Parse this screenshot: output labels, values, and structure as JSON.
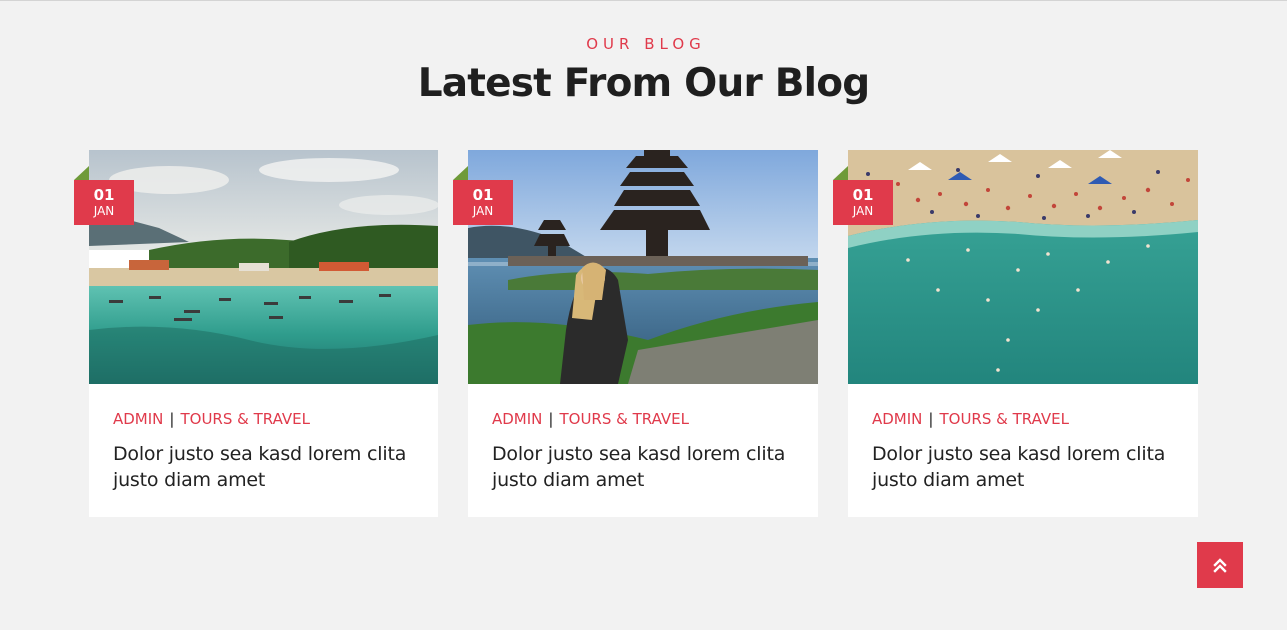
{
  "section": {
    "eyebrow": "OUR BLOG",
    "title": "Latest From Our Blog"
  },
  "posts": [
    {
      "date_day": "01",
      "date_month": "JAN",
      "author": "ADMIN",
      "category": "TOURS & TRAVEL",
      "title": "Dolor justo sea kasd lorem clita justo diam amet",
      "image": "tropical-beach-boats-photo"
    },
    {
      "date_day": "01",
      "date_month": "JAN",
      "author": "ADMIN",
      "category": "TOURS & TRAVEL",
      "title": "Dolor justo sea kasd lorem clita justo diam amet",
      "image": "lake-temple-woman-photo"
    },
    {
      "date_day": "01",
      "date_month": "JAN",
      "author": "ADMIN",
      "category": "TOURS & TRAVEL",
      "title": "Dolor justo sea kasd lorem clita justo diam amet",
      "image": "crowded-beach-aerial-photo"
    }
  ],
  "back_to_top": {
    "icon": "double-chevron-up-icon"
  },
  "colors": {
    "accent": "#e03a4b",
    "fold": "#6f9a39",
    "background": "#f2f2f2"
  }
}
